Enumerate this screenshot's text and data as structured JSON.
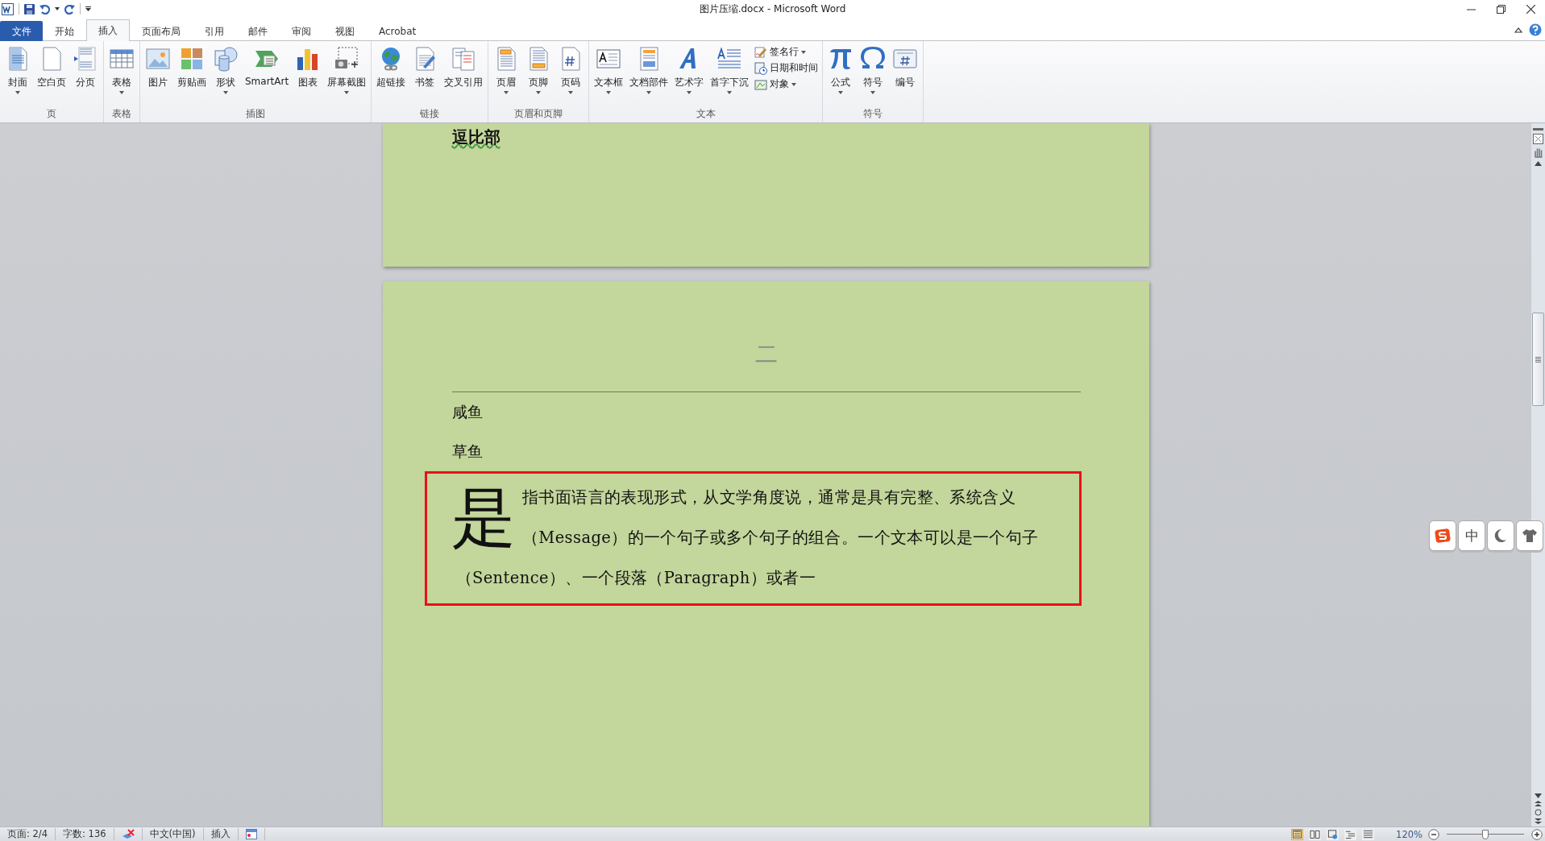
{
  "window": {
    "title": "图片压缩.docx - Microsoft Word"
  },
  "tabs": [
    {
      "label": "文件",
      "kind": "file",
      "selected": false
    },
    {
      "label": "开始",
      "kind": "tab",
      "selected": false
    },
    {
      "label": "插入",
      "kind": "tab",
      "selected": true
    },
    {
      "label": "页面布局",
      "kind": "tab",
      "selected": false
    },
    {
      "label": "引用",
      "kind": "tab",
      "selected": false
    },
    {
      "label": "邮件",
      "kind": "tab",
      "selected": false
    },
    {
      "label": "审阅",
      "kind": "tab",
      "selected": false
    },
    {
      "label": "视图",
      "kind": "tab",
      "selected": false
    },
    {
      "label": "Acrobat",
      "kind": "tab",
      "selected": false
    }
  ],
  "ribbon": {
    "groups": [
      {
        "label": "页",
        "buttons": [
          {
            "label": "封面",
            "dropdown": true
          },
          {
            "label": "空白页",
            "dropdown": false
          },
          {
            "label": "分页",
            "dropdown": false
          }
        ]
      },
      {
        "label": "表格",
        "buttons": [
          {
            "label": "表格",
            "dropdown": true
          }
        ]
      },
      {
        "label": "插图",
        "buttons": [
          {
            "label": "图片",
            "dropdown": false
          },
          {
            "label": "剪贴画",
            "dropdown": false
          },
          {
            "label": "形状",
            "dropdown": true
          },
          {
            "label": "SmartArt",
            "dropdown": false
          },
          {
            "label": "图表",
            "dropdown": false
          },
          {
            "label": "屏幕截图",
            "dropdown": true
          }
        ]
      },
      {
        "label": "链接",
        "buttons": [
          {
            "label": "超链接",
            "dropdown": false
          },
          {
            "label": "书签",
            "dropdown": false
          },
          {
            "label": "交叉引用",
            "dropdown": false
          }
        ]
      },
      {
        "label": "页眉和页脚",
        "buttons": [
          {
            "label": "页眉",
            "dropdown": true
          },
          {
            "label": "页脚",
            "dropdown": true
          },
          {
            "label": "页码",
            "dropdown": true
          }
        ]
      },
      {
        "label": "文本",
        "buttons": [
          {
            "label": "文本框",
            "dropdown": true
          },
          {
            "label": "文档部件",
            "dropdown": true
          },
          {
            "label": "艺术字",
            "dropdown": true
          },
          {
            "label": "首字下沉",
            "dropdown": true
          }
        ],
        "small_buttons": [
          {
            "label": "签名行",
            "dropdown": true
          },
          {
            "label": "日期和时间",
            "dropdown": false
          },
          {
            "label": "对象",
            "dropdown": true
          }
        ]
      },
      {
        "label": "符号",
        "buttons": [
          {
            "label": "公式",
            "dropdown": true
          },
          {
            "label": "符号",
            "dropdown": true
          },
          {
            "label": "编号",
            "dropdown": false
          }
        ]
      }
    ]
  },
  "document": {
    "previous_page_text": "逗比部",
    "header_text": "二",
    "paragraphs": [
      "咸鱼",
      "草鱼"
    ],
    "drop_cap": "是",
    "highlighted_paragraph": "指书面语言的表现形式，从文学角度说，通常是具有完整、系统含义（Message）的一个句子或多个句子的组合。一个文本可以是一个句子（Sentence）、一个段落（Paragraph）或者一"
  },
  "ime_toolbar": {
    "mode": "中"
  },
  "status_bar": {
    "page": "页面: 2/4",
    "words": "字数: 136",
    "language": "中文(中国)",
    "mode": "插入",
    "views": [
      {
        "selected": true
      },
      {
        "selected": false
      },
      {
        "selected": false
      },
      {
        "selected": false
      },
      {
        "selected": false
      }
    ],
    "zoom": "120%",
    "zoom_slider": {
      "level": 0.5
    }
  }
}
